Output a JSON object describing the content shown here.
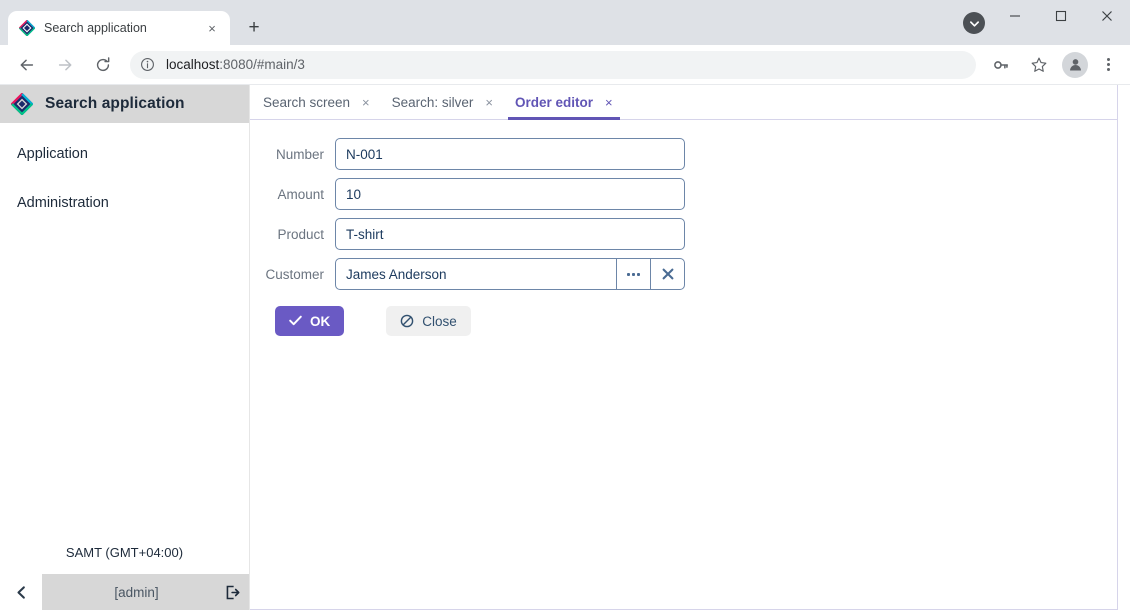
{
  "browser": {
    "tab": {
      "title": "Search application",
      "favicon": "app-diamond-icon",
      "close": "×"
    },
    "new_tab": "+",
    "window_controls": {
      "minimize": "—",
      "maximize": "□",
      "close": "✕"
    },
    "title_bar_chevron": "chevron-down-icon",
    "nav": {
      "back": "←",
      "forward": "→",
      "reload": "⟳"
    },
    "omnibox": {
      "info_icon": "site-info-icon",
      "url_host": "localhost",
      "url_rest": ":8080/#main/3",
      "full_url": "localhost:8080/#main/3",
      "key_icon": "password-key-icon",
      "star_icon": "bookmark-star-icon",
      "profile_icon": "profile-avatar-icon",
      "menu_icon": "kebab-menu-icon"
    }
  },
  "sidebar": {
    "logo": "app-diamond-icon",
    "title": "Search application",
    "items": [
      {
        "label": "Application"
      },
      {
        "label": "Administration"
      }
    ],
    "timezone": "SAMT (GMT+04:00)",
    "collapse_icon": "chevron-left-icon",
    "user": "[admin]",
    "logout_icon": "logout-icon"
  },
  "main": {
    "tabs": [
      {
        "label": "Search screen",
        "close": "×",
        "active": false
      },
      {
        "label": "Search: silver",
        "close": "×",
        "active": false
      },
      {
        "label": "Order editor",
        "close": "×",
        "active": true
      }
    ],
    "form": {
      "fields": [
        {
          "label": "Number",
          "value": "N-001",
          "type": "text"
        },
        {
          "label": "Amount",
          "value": "10",
          "type": "text"
        },
        {
          "label": "Product",
          "value": "T-shirt",
          "type": "text"
        },
        {
          "label": "Customer",
          "value": "James Anderson",
          "type": "lookup",
          "lookup_icon": "ellipsis-icon",
          "clear_icon": "clear-x-icon"
        }
      ],
      "buttons": {
        "ok": {
          "label": "OK",
          "icon": "check-icon"
        },
        "close": {
          "label": "Close",
          "icon": "ban-icon"
        }
      }
    }
  },
  "colors": {
    "accent_purple": "#6155b5",
    "button_purple": "#6a5ac4",
    "field_border": "#6d86a8",
    "field_text": "#1c3a5e",
    "label_gray": "#6b7480",
    "chrome_titlebar": "#dee1e6",
    "sidebar_header": "#d7d7d7",
    "tab_border": "#d6d4ea"
  }
}
